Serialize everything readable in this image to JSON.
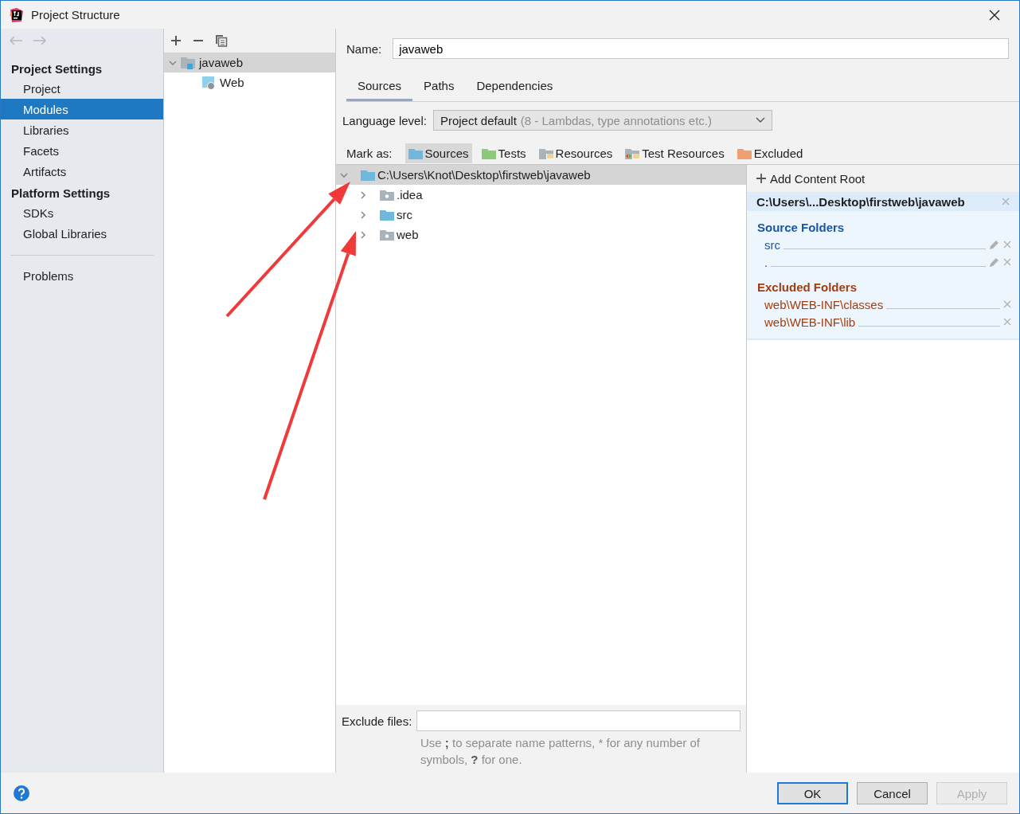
{
  "window": {
    "title": "Project Structure"
  },
  "sidebar": {
    "sections": [
      {
        "title": "Project Settings",
        "items": [
          {
            "label": "Project",
            "selected": false
          },
          {
            "label": "Modules",
            "selected": true
          },
          {
            "label": "Libraries",
            "selected": false
          },
          {
            "label": "Facets",
            "selected": false
          },
          {
            "label": "Artifacts",
            "selected": false
          }
        ]
      },
      {
        "title": "Platform Settings",
        "items": [
          {
            "label": "SDKs",
            "selected": false
          },
          {
            "label": "Global Libraries",
            "selected": false
          }
        ]
      }
    ],
    "bottom_items": [
      {
        "label": "Problems",
        "selected": false
      }
    ]
  },
  "module_tree": [
    {
      "label": "javaweb",
      "kind": "module",
      "selected": true,
      "expanded": true,
      "children": [
        {
          "label": "Web",
          "kind": "facet",
          "selected": false
        }
      ]
    }
  ],
  "name_field": {
    "label": "Name:",
    "value": "javaweb"
  },
  "tabs": [
    {
      "label": "Sources",
      "selected": true
    },
    {
      "label": "Paths",
      "selected": false
    },
    {
      "label": "Dependencies",
      "selected": false
    }
  ],
  "language_level": {
    "label": "Language level:",
    "value": "Project default",
    "hint": "(8 - Lambdas, type annotations etc.)"
  },
  "mark_as": {
    "label": "Mark as:",
    "buttons": [
      {
        "label": "Sources",
        "kind": "sources",
        "selected": true
      },
      {
        "label": "Tests",
        "kind": "tests",
        "selected": false
      },
      {
        "label": "Resources",
        "kind": "resources",
        "selected": false
      },
      {
        "label": "Test Resources",
        "kind": "test_resources",
        "selected": false
      },
      {
        "label": "Excluded",
        "kind": "excluded",
        "selected": false
      }
    ]
  },
  "folder_tree": [
    {
      "label": "C:\\Users\\Knot\\Desktop\\firstweb\\javaweb",
      "kind": "sources",
      "selected": true,
      "expanded": true,
      "children": [
        {
          "label": ".idea",
          "kind": "plain",
          "selected": false,
          "expanded": false
        },
        {
          "label": "src",
          "kind": "sources",
          "selected": false,
          "expanded": false
        },
        {
          "label": "web",
          "kind": "plain",
          "selected": false,
          "expanded": false
        }
      ]
    }
  ],
  "exclude_files": {
    "label": "Exclude files:",
    "help": "Use **;** to separate name patterns, * for any number of symbols, **?** for one."
  },
  "content_root": {
    "add_label": "Add Content Root",
    "path": "C:\\Users\\...Desktop\\firstweb\\javaweb",
    "groups": [
      {
        "title": "Source Folders",
        "kind": "source",
        "items": [
          "src",
          "."
        ]
      },
      {
        "title": "Excluded Folders",
        "kind": "excluded",
        "items": [
          "web\\WEB-INF\\classes",
          "web\\WEB-INF\\lib"
        ]
      }
    ]
  },
  "buttons": [
    {
      "label": "OK",
      "default": true,
      "disabled": false
    },
    {
      "label": "Cancel",
      "default": false,
      "disabled": false
    },
    {
      "label": "Apply",
      "default": false,
      "disabled": true
    }
  ]
}
